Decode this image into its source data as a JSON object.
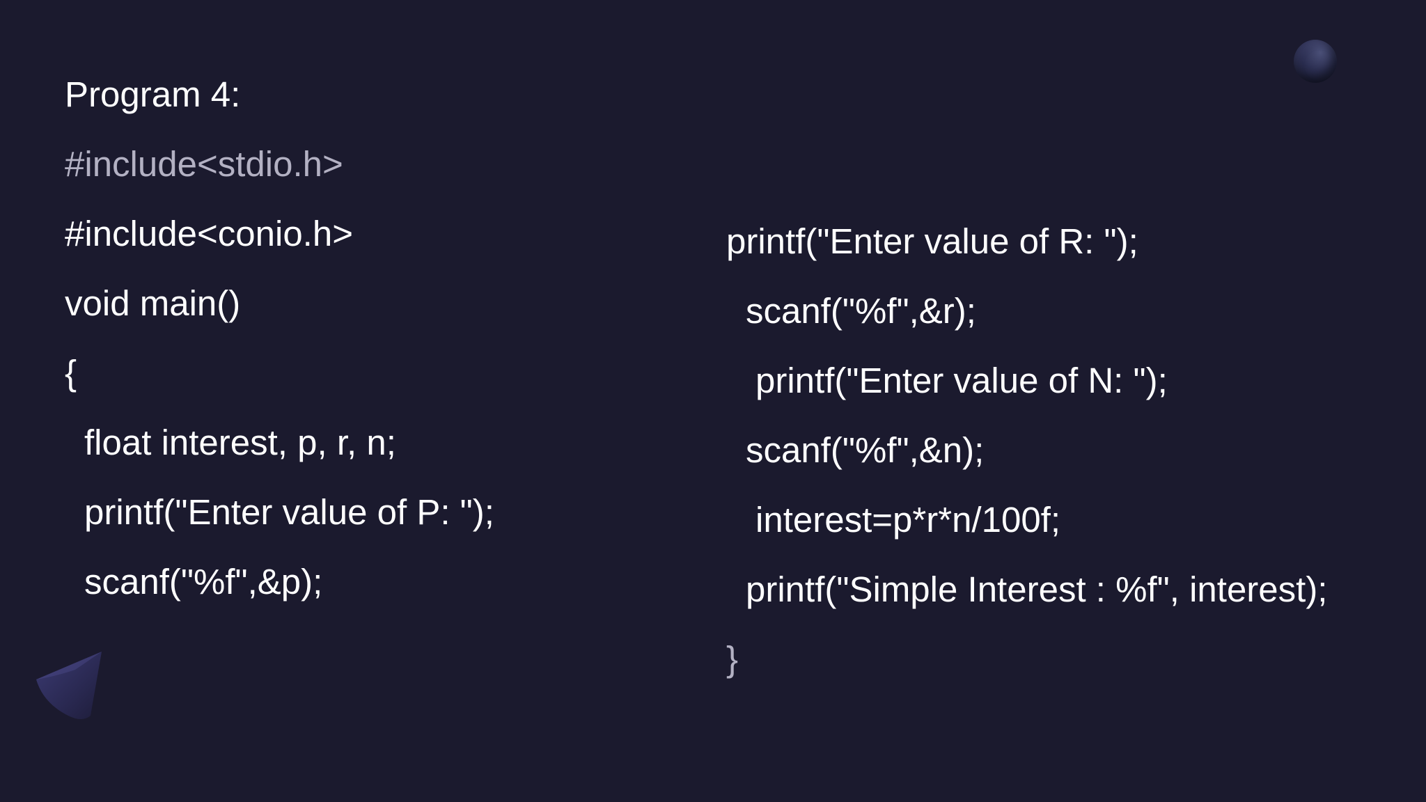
{
  "slide": {
    "title": "Program 4:",
    "left_code": [
      "#include<stdio.h>",
      "#include<conio.h>",
      "void main()",
      "{",
      "float interest, p, r, n;",
      "printf(\"Enter value of P: \");",
      "scanf(\"%f\",&p);"
    ],
    "right_code": [
      "printf(\"Enter value of R: \");",
      "scanf(\"%f\",&r);",
      "printf(\"Enter value of N: \");",
      "scanf(\"%f\",&n);",
      "interest=p*r*n/100f;",
      "printf(\"Simple Interest : %f\", interest);",
      "}"
    ]
  },
  "decorations": {
    "orb_icon": "sphere-decoration-icon",
    "cone_icon": "cone-decoration-icon"
  },
  "colors": {
    "background": "#1b1a2e",
    "text": "#ffffff",
    "dim_text": "#b3b1c3"
  }
}
